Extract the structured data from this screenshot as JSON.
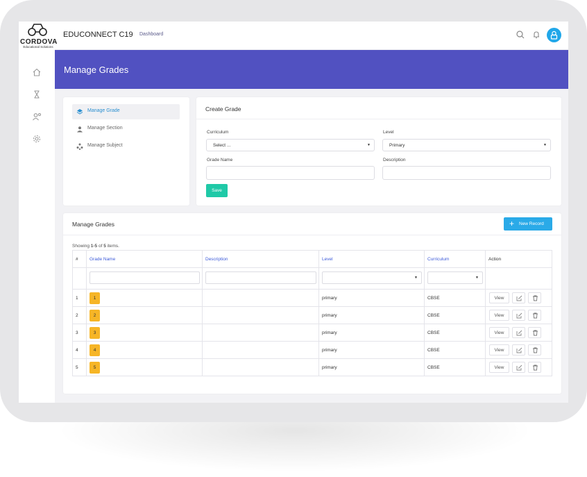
{
  "app": {
    "brand": "CORDOVA",
    "brand_sub": "Educational Solutions",
    "title": "EDUCONNECT C19",
    "nav_link": "Dashboard"
  },
  "page": {
    "title": "Manage Grades"
  },
  "side_menu": [
    {
      "label": "Manage Grade",
      "icon": "layers-icon",
      "active": true
    },
    {
      "label": "Manage Section",
      "icon": "user-icon",
      "active": false
    },
    {
      "label": "Manage Subject",
      "icon": "subject-icon",
      "active": false
    }
  ],
  "create_form": {
    "title": "Create Grade",
    "curriculum_label": "Curriculum",
    "curriculum_value": "Select ...",
    "level_label": "Level",
    "level_value": "Primary",
    "grade_name_label": "Grade Name",
    "description_label": "Description",
    "save_label": "Save"
  },
  "grid": {
    "title": "Manage Grades",
    "new_record_label": "New Record",
    "summary_prefix": "Showing ",
    "summary_range": "1-5",
    "summary_mid": " of ",
    "summary_total": "5",
    "summary_suffix": " items.",
    "headers": {
      "num": "#",
      "grade_name": "Grade Name",
      "description": "Description",
      "level": "Level",
      "curriculum": "Curriculum",
      "action": "Action"
    },
    "view_label": "View",
    "rows": [
      {
        "num": "1",
        "grade": "1",
        "description": "",
        "level": "primary",
        "curriculum": "CBSE"
      },
      {
        "num": "2",
        "grade": "2",
        "description": "",
        "level": "primary",
        "curriculum": "CBSE"
      },
      {
        "num": "3",
        "grade": "3",
        "description": "",
        "level": "primary",
        "curriculum": "CBSE"
      },
      {
        "num": "4",
        "grade": "4",
        "description": "",
        "level": "primary",
        "curriculum": "CBSE"
      },
      {
        "num": "5",
        "grade": "5",
        "description": "",
        "level": "primary",
        "curriculum": "CBSE"
      }
    ]
  },
  "colors": {
    "banner": "#5151c1",
    "save": "#1fc9a7",
    "new_record": "#2aaae8",
    "badge": "#f6b526",
    "link": "#3d5bd9"
  }
}
